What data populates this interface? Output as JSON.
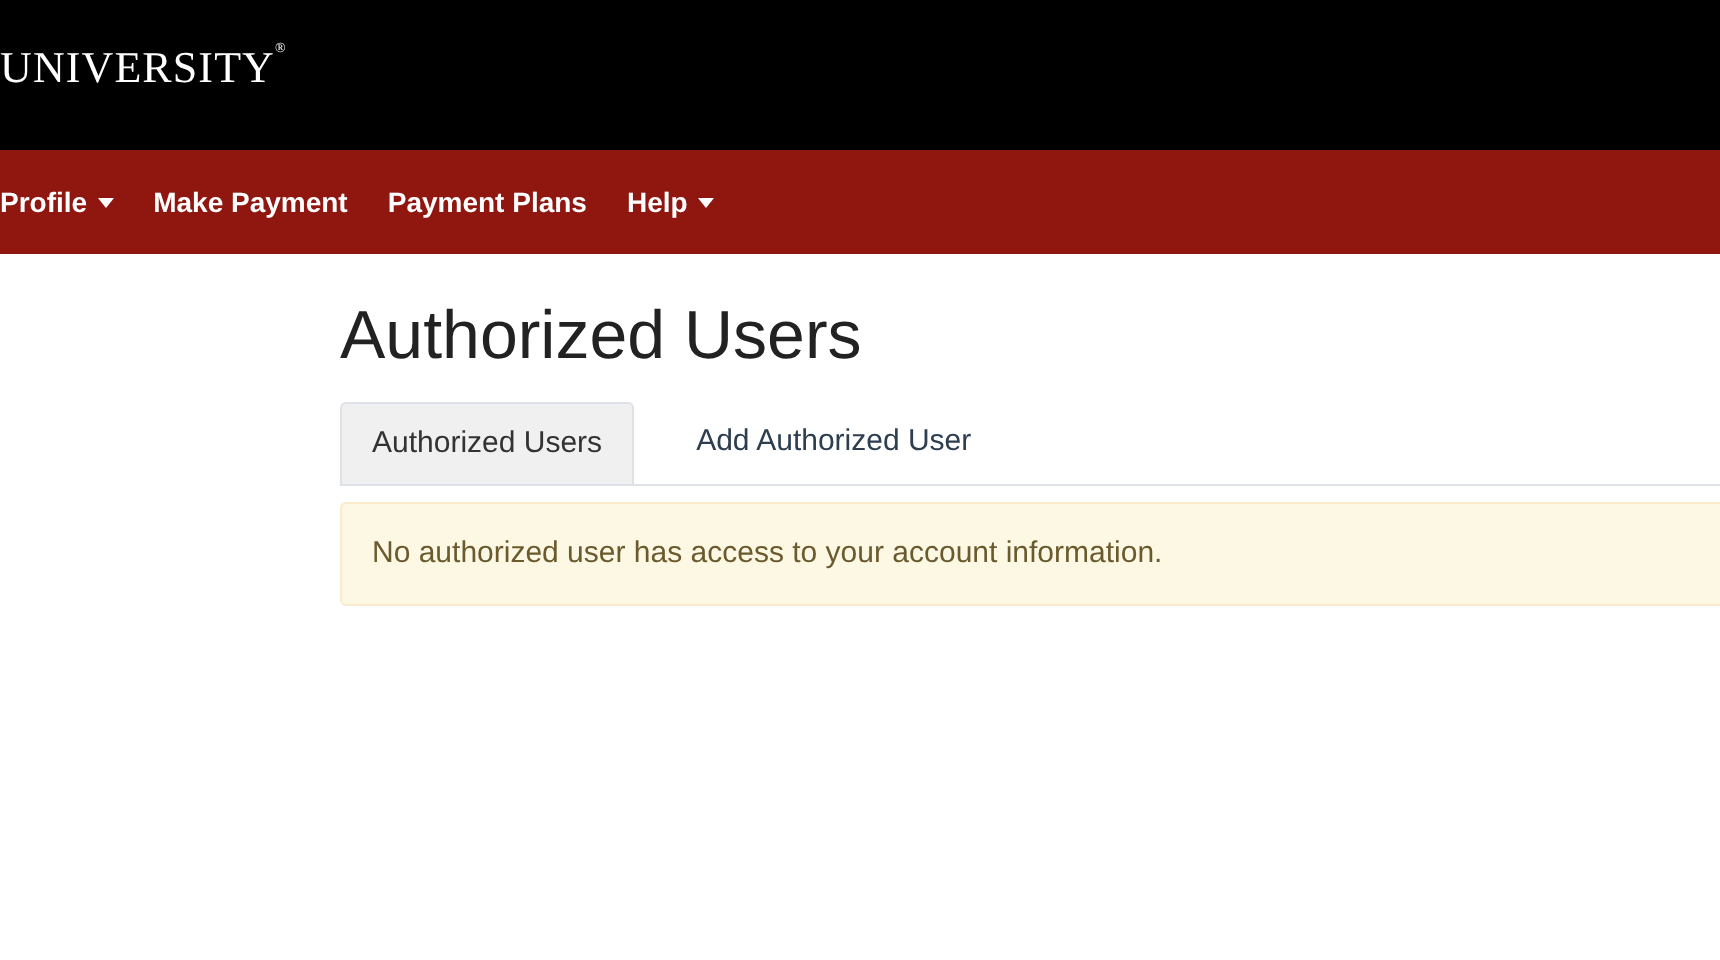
{
  "header": {
    "logo_text": "UNIVERSITY",
    "logo_mark": "®"
  },
  "nav": [
    {
      "label": "Profile",
      "dropdown": true
    },
    {
      "label": "Make Payment",
      "dropdown": false
    },
    {
      "label": "Payment Plans",
      "dropdown": false
    },
    {
      "label": "Help",
      "dropdown": true
    }
  ],
  "page_title": "Authorized Users",
  "tabs": [
    {
      "label": "Authorized Users",
      "selected": true
    },
    {
      "label": "Add Authorized User",
      "selected": false
    }
  ],
  "alert": {
    "message": "No authorized user has access to your account information."
  }
}
